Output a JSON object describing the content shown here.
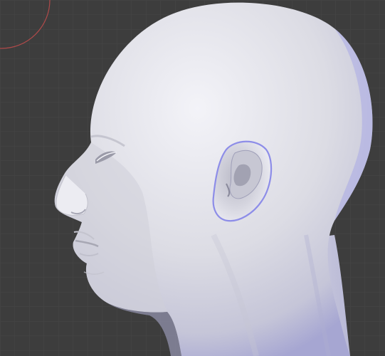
{
  "viewport": {
    "background_color": "#3d3d3d",
    "grid_line_color": "#4a4a4a",
    "selection_circle_color": "#b04a4a",
    "mesh_base_color": "#d6d6df",
    "mesh_highlight_color": "#f2f2f7",
    "mesh_shadow_color": "#9d9dc6",
    "rim_light_color": "#8888f0",
    "object": "head-sculpt-mesh"
  }
}
